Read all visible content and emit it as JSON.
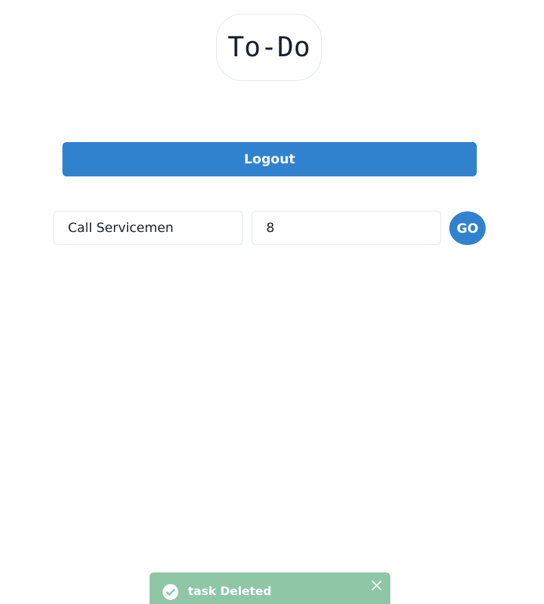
{
  "header": {
    "title": "To-Do"
  },
  "actions": {
    "logout_label": "Logout"
  },
  "form": {
    "task_value": "Call Servicemen",
    "number_value": "8",
    "submit_label": "GO"
  },
  "toast": {
    "message": "task Deleted",
    "icon": "check-circle-icon",
    "close_icon": "close-icon",
    "background_color": "#8fc7a6"
  },
  "colors": {
    "accent": "#3182ce",
    "border": "#e2e8f0",
    "text": "#1a202c"
  }
}
